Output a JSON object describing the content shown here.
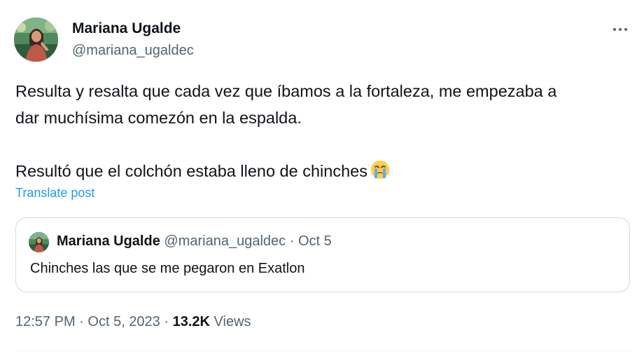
{
  "author": {
    "name": "Mariana Ugalde",
    "handle": "@mariana_ugaldec"
  },
  "post": {
    "line1": "Resulta y resalta que cada vez que íbamos a la fortaleza, me empezaba a",
    "line2": "dar muchísima comezón en la espalda.",
    "line3": "Resultó que el colchón estaba lleno de chinches",
    "emoji": "loudly-crying-face-emoji"
  },
  "translate_label": "Translate post",
  "quote": {
    "name": "Mariana Ugalde",
    "handle": "@mariana_ugaldec",
    "separator": "·",
    "date": "Oct 5",
    "text": "Chinches las que se me pegaron en Exatlon"
  },
  "meta": {
    "time": "12:57 PM",
    "separator": "·",
    "date": "Oct 5, 2023",
    "views_count": "13.2K",
    "views_label": "Views"
  },
  "icons": {
    "more": "more-options-icon"
  },
  "colors": {
    "link": "#1d9bf0",
    "secondary_text": "#536471",
    "primary_text": "#0f1419",
    "border": "#cfd9de"
  }
}
